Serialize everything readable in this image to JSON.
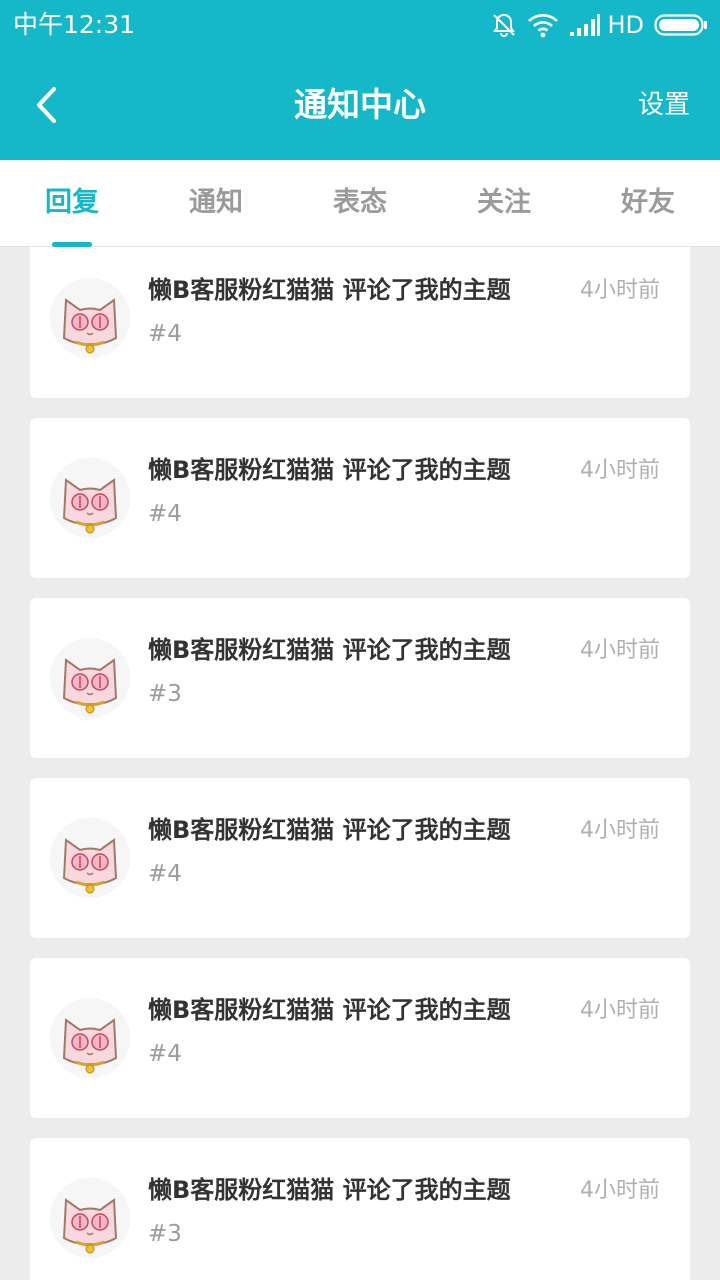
{
  "status_bar": {
    "time": "中午12:31",
    "network": "HD",
    "icons": [
      "bell-off-icon",
      "wifi-icon",
      "signal-icon",
      "battery-icon"
    ]
  },
  "header": {
    "title": "通知中心",
    "settings_label": "设置",
    "back_icon": "chevron-left-icon"
  },
  "tabs": [
    {
      "label": "回复",
      "active": true
    },
    {
      "label": "通知",
      "active": false
    },
    {
      "label": "表态",
      "active": false
    },
    {
      "label": "关注",
      "active": false
    },
    {
      "label": "好友",
      "active": false
    }
  ],
  "notifications": [
    {
      "user": "懒B客服粉红猫猫",
      "action": "评论了我的主题",
      "time": "4小时前",
      "floor": "#4"
    },
    {
      "user": "懒B客服粉红猫猫",
      "action": "评论了我的主题",
      "time": "4小时前",
      "floor": "#4"
    },
    {
      "user": "懒B客服粉红猫猫",
      "action": "评论了我的主题",
      "time": "4小时前",
      "floor": "#3"
    },
    {
      "user": "懒B客服粉红猫猫",
      "action": "评论了我的主题",
      "time": "4小时前",
      "floor": "#4"
    },
    {
      "user": "懒B客服粉红猫猫",
      "action": "评论了我的主题",
      "time": "4小时前",
      "floor": "#4"
    },
    {
      "user": "懒B客服粉红猫猫",
      "action": "评论了我的主题",
      "time": "4小时前",
      "floor": "#3"
    }
  ],
  "colors": {
    "accent": "#15b8c8",
    "background": "#ececec",
    "card": "#ffffff"
  }
}
